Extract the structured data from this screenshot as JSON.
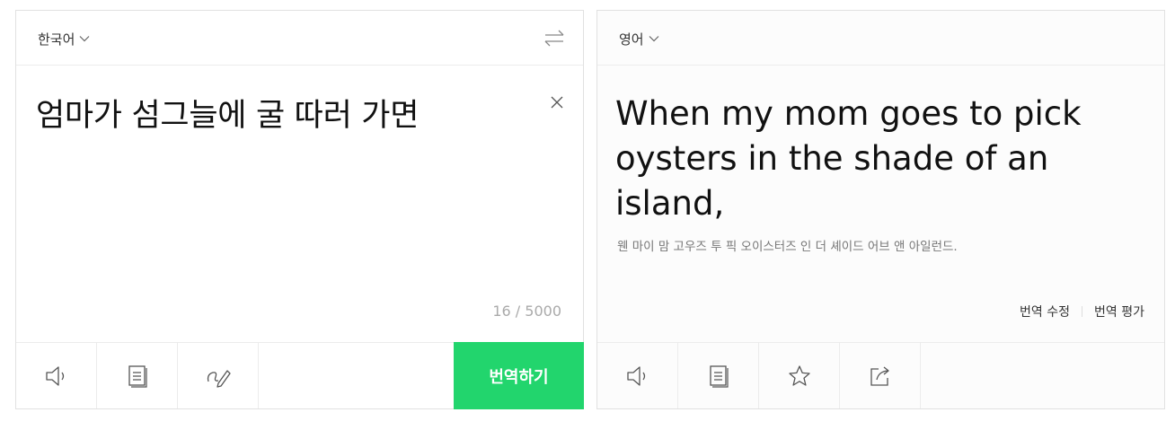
{
  "source": {
    "language": "한국어",
    "text": "엄마가 섬그늘에 굴 따러 가면",
    "counter": "16 / 5000",
    "translate_label": "번역하기",
    "tools": [
      "speaker-icon",
      "dictionary-icon",
      "handwriting-icon"
    ]
  },
  "target": {
    "language": "영어",
    "text": "When my mom goes to pick oysters in the shade of an island,",
    "pronunciation": "웬 마이 맘 고우즈 투 픽 오이스터즈 인 더 셰이드 어브 앤 아일런드.",
    "edit_label": "번역 수정",
    "rate_label": "번역 평가",
    "tools": [
      "speaker-icon",
      "copy-icon",
      "star-icon",
      "share-icon"
    ]
  },
  "colors": {
    "accent": "#22d56d",
    "border": "#e1e1e1",
    "muted_text": "#aaaaaa"
  }
}
